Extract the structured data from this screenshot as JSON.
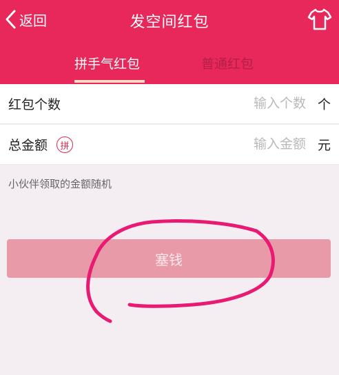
{
  "header": {
    "back_label": "返回",
    "title": "发空间红包",
    "shirt_icon": "tshirt-icon",
    "background": "#e8285a"
  },
  "tabs": [
    {
      "label": "拼手气红包",
      "active": true
    },
    {
      "label": "普通红包",
      "active": false
    }
  ],
  "form": {
    "count": {
      "label": "红包个数",
      "placeholder": "输入个数",
      "unit": "个"
    },
    "amount": {
      "label": "总金额",
      "badge": "拼",
      "placeholder": "输入金额",
      "unit": "元"
    }
  },
  "hint": "小伙伴领取的金额随机",
  "submit_label": "塞钱",
  "colors": {
    "accent": "#e8285a",
    "button": "#e99aa8",
    "annotation": "#e81a72"
  }
}
